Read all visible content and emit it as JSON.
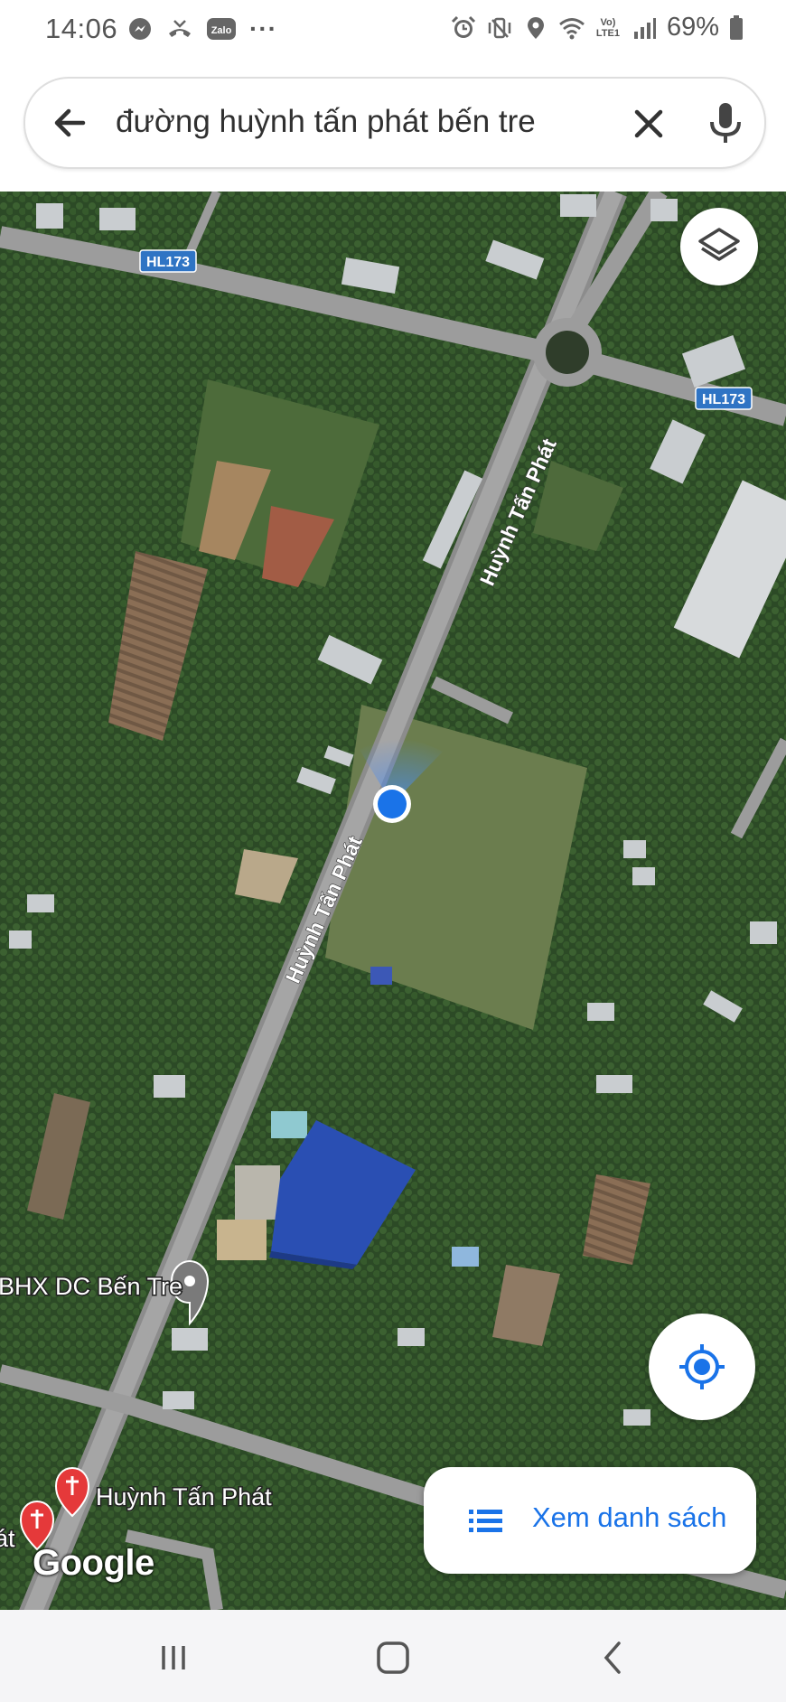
{
  "status_bar": {
    "time": "14:06",
    "battery_text": "69%",
    "network_label": "Vo) LTE1",
    "left_icons": [
      "messenger-icon",
      "missed-call-icon",
      "zalo-icon",
      "more-icon"
    ],
    "right_icons": [
      "alarm-icon",
      "vibrate-icon",
      "location-icon",
      "wifi-icon",
      "signal-icon",
      "battery-icon"
    ],
    "zalo_text": "Zalo",
    "more_text": "···"
  },
  "search": {
    "query": "đường huỳnh tấn phát bến tre"
  },
  "map": {
    "road_labels": {
      "main_north": "Huỳnh Tấn Phát",
      "main_south": "Huỳnh Tấn Phát"
    },
    "route_shields": {
      "west": "HL173",
      "east": "HL173"
    },
    "pois": {
      "store": "BHX DC Bến Tre",
      "red_marker": "Huỳnh Tấn Phát",
      "edge_text": "át"
    },
    "attribution": "Google"
  },
  "list_button": {
    "label": "Xem danh sách"
  },
  "colors": {
    "accent": "#1a73e8",
    "location_dot": "#1a73e8",
    "marker_red": "#e5393a",
    "shield_blue": "#2f74c4"
  }
}
